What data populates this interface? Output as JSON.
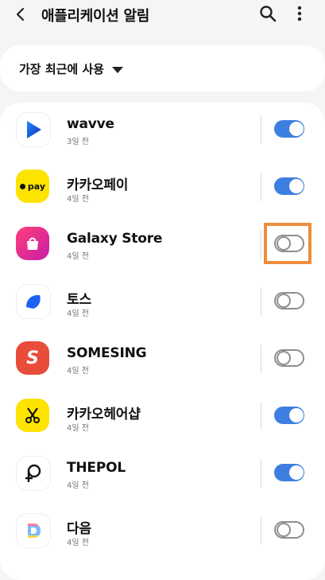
{
  "header": {
    "title": "애플리케이션 알림",
    "back_icon": "back-arrow-icon",
    "search_icon": "search-icon",
    "more_icon": "more-vertical-icon"
  },
  "sort": {
    "label": "가장 최근에 사용"
  },
  "colors": {
    "toggle_on": "#3d7fe0",
    "highlight": "#ef8d3c"
  },
  "apps": [
    {
      "name": "wavve",
      "time": "3일 전",
      "enabled": true,
      "icon": "wavve-icon"
    },
    {
      "name": "카카오페이",
      "time": "4일 전",
      "enabled": true,
      "icon": "kakaopay-icon",
      "icon_text": "pay"
    },
    {
      "name": "Galaxy Store",
      "time": "4일 전",
      "enabled": false,
      "icon": "galaxy-store-icon",
      "highlighted": true
    },
    {
      "name": "토스",
      "time": "4일 전",
      "enabled": false,
      "icon": "toss-icon"
    },
    {
      "name": "SOMESING",
      "time": "4일 전",
      "enabled": false,
      "icon": "somesing-icon"
    },
    {
      "name": "카카오헤어샵",
      "time": "4일 전",
      "enabled": true,
      "icon": "kakao-hairshop-icon"
    },
    {
      "name": "THEPOL",
      "time": "4일 전",
      "enabled": true,
      "icon": "thepol-icon"
    },
    {
      "name": "다음",
      "time": "4일 전",
      "enabled": false,
      "icon": "daum-icon"
    }
  ]
}
